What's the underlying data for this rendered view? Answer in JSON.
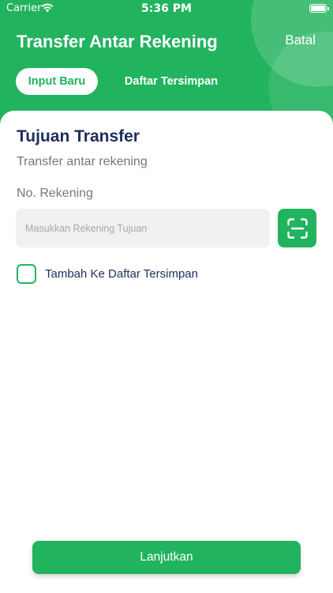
{
  "status_bar": {
    "carrier": "Carrier",
    "time": "5:36 PM"
  },
  "header": {
    "title": "Transfer Antar Rekening",
    "cancel_label": "Batal"
  },
  "tabs": [
    {
      "label": "Input Baru",
      "active": true
    },
    {
      "label": "Daftar Tersimpan",
      "active": false
    }
  ],
  "form": {
    "section_title": "Tujuan Transfer",
    "section_subtitle": "Transfer antar rekening",
    "account_label": "No. Rekening",
    "account_value": "",
    "account_placeholder": "Masukkan Rekening Tujuan",
    "scan_icon": "scan-icon",
    "save_checkbox_label": "Tambah Ke Daftar Tersimpan",
    "save_checked": false
  },
  "footer": {
    "continue_label": "Lanjutkan"
  },
  "colors": {
    "primary": "#22b35e",
    "heading": "#1f2d5a",
    "muted": "#777777",
    "input_bg": "#f1f1f1"
  }
}
